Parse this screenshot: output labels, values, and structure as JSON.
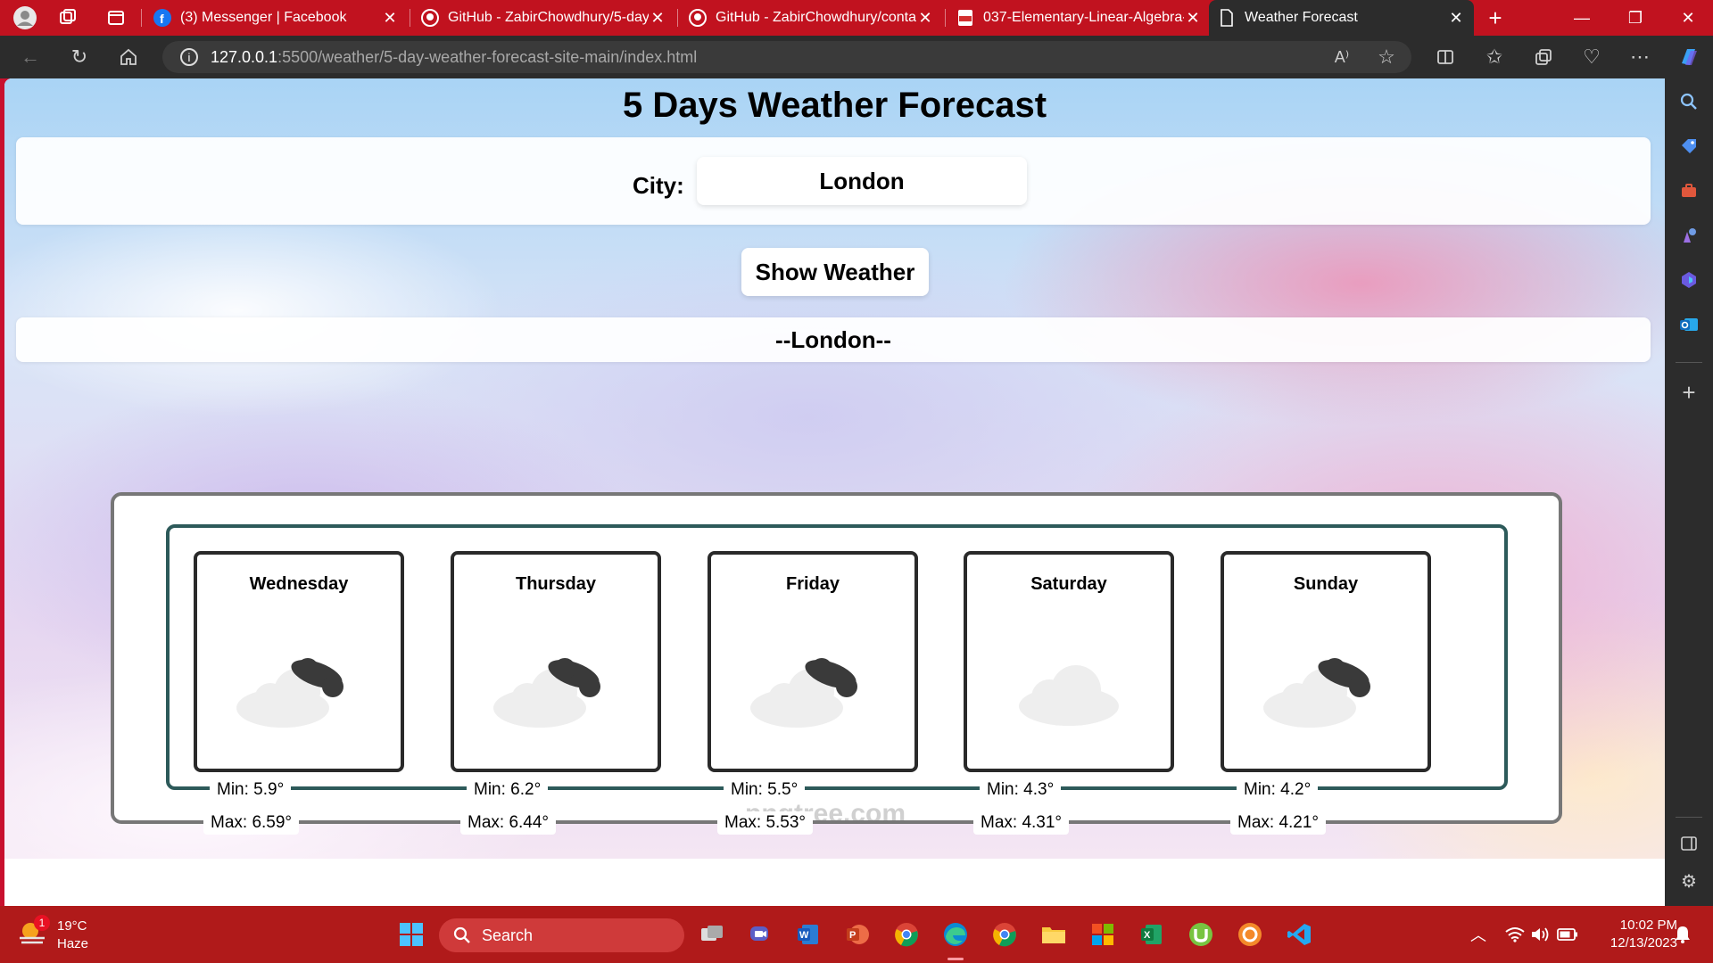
{
  "browser": {
    "tabs": [
      {
        "title": "(3) Messenger | Facebook",
        "icon": "facebook-icon"
      },
      {
        "title": "GitHub - ZabirChowdhury/5-day",
        "icon": "github-icon"
      },
      {
        "title": "GitHub - ZabirChowdhury/conta",
        "icon": "github-icon"
      },
      {
        "title": "037-Elementary-Linear-Algebra-",
        "icon": "pdf-icon"
      },
      {
        "title": "Weather Forecast",
        "icon": "page-icon",
        "active": true
      }
    ],
    "url_host": "127.0.0.1",
    "url_path": ":5500/weather/5-day-weather-forecast-site-main/index.html"
  },
  "page": {
    "title": "5 Days Weather Forecast",
    "city_label": "City:",
    "city_value": "London",
    "button_label": "Show Weather",
    "city_heading": "--London--",
    "watermark": "pngtree.com",
    "days": [
      {
        "name": "Wednesday",
        "min": "Min: 5.9°",
        "max": "Max: 6.59°",
        "icon": "cloudy-night-icon"
      },
      {
        "name": "Thursday",
        "min": "Min: 6.2°",
        "max": "Max: 6.44°",
        "icon": "cloudy-night-icon"
      },
      {
        "name": "Friday",
        "min": "Min: 5.5°",
        "max": "Max: 5.53°",
        "icon": "cloudy-night-icon"
      },
      {
        "name": "Saturday",
        "min": "Min: 4.3°",
        "max": "Max: 4.31°",
        "icon": "cloud-icon"
      },
      {
        "name": "Sunday",
        "min": "Min: 4.2°",
        "max": "Max: 4.21°",
        "icon": "cloudy-night-icon"
      }
    ]
  },
  "taskbar": {
    "weather_temp": "19°C",
    "weather_desc": "Haze",
    "weather_badge": "1",
    "search_label": "Search",
    "time": "10:02 PM",
    "date": "12/13/2023"
  },
  "colors": {
    "tabstrip": "#c1121f",
    "toolbar": "#2c2c2c",
    "taskbar": "#b01a1a",
    "card_border": "#2a2a2a",
    "inner_border": "#2d5a5a"
  }
}
